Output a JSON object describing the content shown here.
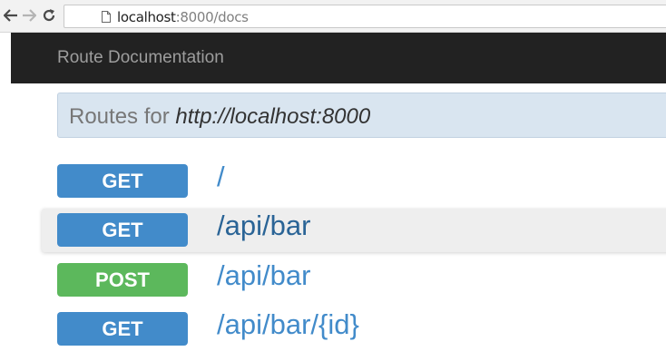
{
  "browser": {
    "url_host": "localhost",
    "url_path": ":8000/docs"
  },
  "navbar": {
    "brand": "Route Documentation"
  },
  "header": {
    "prefix": "Routes for ",
    "host": "http://localhost:8000"
  },
  "routes": [
    {
      "method": "GET",
      "path": "/"
    },
    {
      "method": "GET",
      "path": "/api/bar"
    },
    {
      "method": "POST",
      "path": "/api/bar"
    },
    {
      "method": "GET",
      "path": "/api/bar/{id}"
    }
  ],
  "colors": {
    "navbar_bg": "#222222",
    "get_badge": "#428bca",
    "post_badge": "#5cb85c",
    "link": "#428bca",
    "well_bg": "#d9e5f0"
  },
  "icons": {
    "back": "arrow-left-icon",
    "forward": "arrow-right-icon",
    "reload": "reload-icon",
    "page": "page-icon"
  }
}
